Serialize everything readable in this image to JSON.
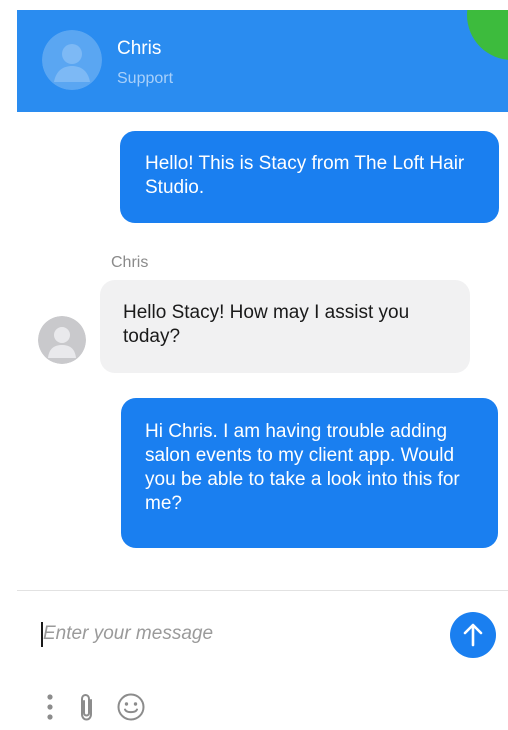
{
  "colors": {
    "header_bg": "#2a8cf0",
    "accent_green": "#3dbb3d",
    "outgoing_bubble": "#1a7ff0",
    "incoming_bubble": "#f1f1f2",
    "send_button": "#1a7ff0",
    "secondary_text": "#8a8a8a",
    "header_sub_text": "#a8d0fa",
    "divider": "#e2e2e2",
    "icon_gray": "#8c8c8c",
    "avatar_bg": "#c9c9cc",
    "avatar_fg": "#e9e9ec"
  },
  "header": {
    "contact_name": "Chris",
    "contact_role": "Support",
    "avatar_icon": "user-avatar-icon"
  },
  "messages": [
    {
      "direction": "outgoing",
      "text": "Hello! This is Stacy from The Loft Hair Studio."
    },
    {
      "direction": "incoming",
      "sender": "Chris",
      "avatar_icon": "user-avatar-icon",
      "text": "Hello Stacy! How may I assist you today?"
    },
    {
      "direction": "outgoing",
      "text": "Hi Chris. I am having trouble adding salon events to my client app. Would you be able to take a look into this for me?"
    }
  ],
  "composer": {
    "placeholder": "Enter your message",
    "value": "",
    "send_icon": "arrow-up-icon",
    "toolbar_icons": [
      "more-vertical-icon",
      "paperclip-icon",
      "smiley-icon"
    ]
  }
}
